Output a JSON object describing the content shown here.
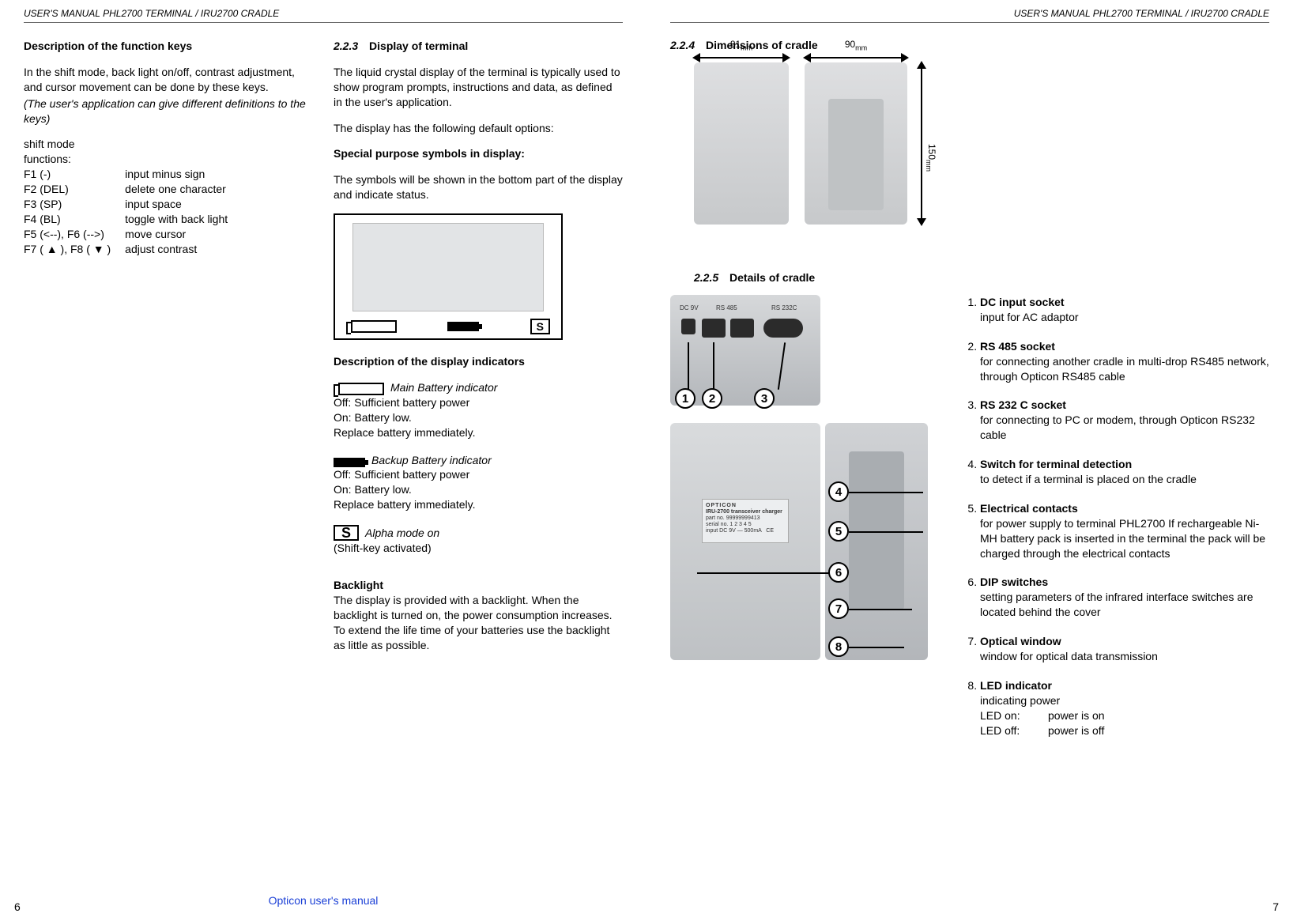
{
  "running_header": "USER'S MANUAL PHL2700 TERMINAL / IRU2700 CRADLE",
  "page_left_num": "6",
  "page_right_num": "7",
  "footer_center": "Opticon user's manual",
  "left": {
    "fkeys_title": "Description of the function keys",
    "fkeys_intro": "In the shift mode, back light on/off, contrast adjustment, and cursor movement can be done by these keys.",
    "fkeys_note": "(The user's application can give different definitions to the keys)",
    "shift_mode_lead1": "shift mode",
    "shift_mode_lead2": "functions:",
    "rows": [
      {
        "k": "F1 (-)",
        "v": "input minus sign"
      },
      {
        "k": "F2 (DEL)",
        "v": "delete one character"
      },
      {
        "k": "F3 (SP)",
        "v": "input space"
      },
      {
        "k": "F4 (BL)",
        "v": "toggle with back light"
      },
      {
        "k": "F5 (<--), F6 (-->)",
        "v": "move cursor"
      },
      {
        "k": "F7 ( ▲ ), F8 ( ▼ )",
        "v": "adjust contrast"
      }
    ],
    "s223_num": "2.2.3",
    "s223_title": "Display of terminal",
    "s223_p1": "The liquid crystal display of the terminal is typically used to show program prompts, instructions and data, as defined in the user's application.",
    "s223_p2": "The display has the following default options:",
    "s223_sps_title": "Special purpose symbols in display:",
    "s223_sps_p": "The symbols will be shown in the bottom part of the display and indicate status.",
    "s223_desc_title": "Description of the display indicators",
    "ind_main_label": "Main Battery indicator",
    "ind_main_l1": "Off: Sufficient battery power",
    "ind_main_l2": "On: Battery low.",
    "ind_main_l3": "Replace battery immediately.",
    "ind_backup_label": "Backup Battery indicator",
    "ind_backup_l1": "Off: Sufficient battery power",
    "ind_backup_l2": "On: Battery low.",
    "ind_backup_l3": "Replace battery immediately.",
    "ind_alpha_letter": "S",
    "ind_alpha_label": "Alpha mode on",
    "ind_alpha_l1": "(Shift-key activated)",
    "backlight_title": "Backlight",
    "backlight_p": "The display is provided with a backlight. When the backlight is turned on, the power consumption increases. To extend the life time of your batteries use the backlight as little as possible."
  },
  "right": {
    "s224_num": "2.2.4",
    "s224_title": "Dimensions of cradle",
    "dim_w_side": "81",
    "dim_w_front": "90",
    "dim_h": "150",
    "dim_unit": "mm",
    "s225_num": "2.2.5",
    "s225_title": "Details of cradle",
    "plate_brand": "OPTICON",
    "plate_model": "IRU-2700 transceiver charger",
    "plate_part_label": "part no.",
    "plate_part": "99999999413",
    "plate_serial_label": "serial no.",
    "plate_serial": "1 2 3 4 5",
    "plate_input_label": "input",
    "plate_input": "DC 9V — 500mA",
    "rear_port_labels": {
      "dc": "DC 9V",
      "rs485": "RS 485",
      "rs232": "RS 232C"
    },
    "callouts": [
      "1",
      "2",
      "3",
      "4",
      "5",
      "6",
      "7",
      "8"
    ],
    "list": [
      {
        "t": "DC input socket",
        "d": "input for AC adaptor"
      },
      {
        "t": "RS 485 socket",
        "d": "for connecting another cradle in multi-drop RS485 network, through Opticon RS485 cable"
      },
      {
        "t": "RS 232 C socket",
        "d": "for connecting to PC or modem, through Opticon RS232 cable"
      },
      {
        "t": "Switch for terminal detection",
        "d": "to detect if a terminal is placed on the cradle"
      },
      {
        "t": "Electrical contacts",
        "d": "for power supply to terminal PHL2700 If rechargeable Ni-MH battery pack is inserted in the terminal the pack will be charged through the electrical contacts"
      },
      {
        "t": "DIP switches",
        "d": "setting parameters of the infrared interface switches are located behind the cover"
      },
      {
        "t": "Optical window",
        "d": "window for optical data transmission"
      },
      {
        "t": "LED indicator",
        "d": "indicating power",
        "led": [
          {
            "a": "LED on:",
            "b": "power is on"
          },
          {
            "a": "LED off:",
            "b": "power is off"
          }
        ]
      }
    ]
  }
}
